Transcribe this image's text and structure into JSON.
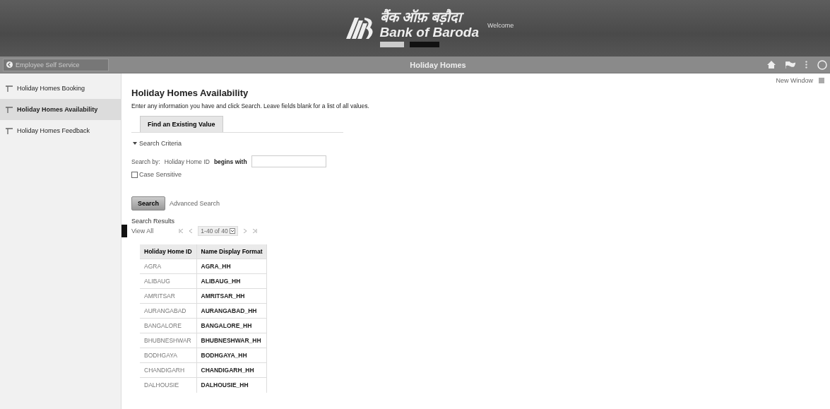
{
  "header": {
    "logo_hindi": "बैंक ऑफ़ बड़ौदा",
    "logo_name": "Bank of Baroda",
    "welcome": "Welcome"
  },
  "navbar": {
    "back_label": "Employee Self Service",
    "title": "Holiday Homes"
  },
  "new_window": "New Window",
  "sidebar": {
    "items": [
      {
        "label": "Holiday Homes Booking",
        "selected": false
      },
      {
        "label": "Holiday Homes Availability",
        "selected": true
      },
      {
        "label": "Holiday Homes Feedback",
        "selected": false
      }
    ]
  },
  "page": {
    "title": "Holiday Homes Availability",
    "instructions": "Enter any information you have and click Search. Leave fields blank for a list of all values.",
    "tab": "Find an Existing Value",
    "criteria_label": "Search Criteria",
    "criteria_expanded": true,
    "search_by_label": "Search by:",
    "search_field": "Holiday Home ID",
    "operator": "begins with",
    "case_sensitive": {
      "label": "Case Sensitive",
      "checked": false
    },
    "search_button": "Search",
    "advanced_link": "Advanced Search"
  },
  "results": {
    "title": "Search Results",
    "view_all": "View All",
    "range": "1-40 of 40",
    "columns": [
      "Holiday Home ID",
      "Name Display Format"
    ],
    "rows": [
      [
        "AGRA",
        "AGRA_HH"
      ],
      [
        "ALIBAUG",
        "ALIBAUG_HH"
      ],
      [
        "AMRITSAR",
        "AMRITSAR_HH"
      ],
      [
        "AURANGABAD",
        "AURANGABAD_HH"
      ],
      [
        "BANGALORE",
        "BANGALORE_HH"
      ],
      [
        "BHUBNESHWAR",
        "BHUBNESHWAR_HH"
      ],
      [
        "BODHGAYA",
        "BODHGAYA_HH"
      ],
      [
        "CHANDIGARH",
        "CHANDIGARH_HH"
      ],
      [
        "DALHOUSIE",
        "DALHOUSIE_HH"
      ]
    ]
  }
}
